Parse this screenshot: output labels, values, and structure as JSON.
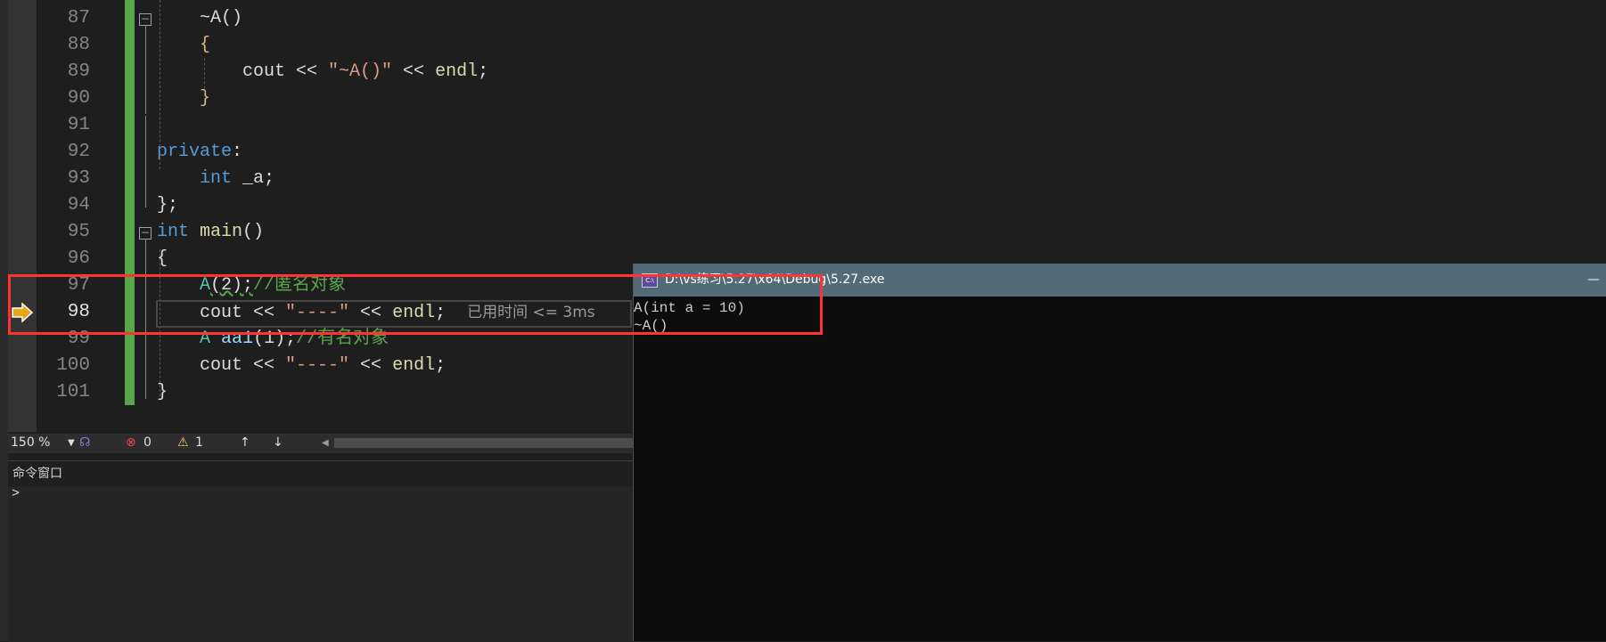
{
  "editor": {
    "current_line": 98,
    "lines": [
      {
        "n": "87",
        "tokens": [
          {
            "t": "    ~A()",
            "c": "#dcdcdc"
          }
        ]
      },
      {
        "n": "88",
        "tokens": [
          {
            "t": "    {",
            "c": "#d7ba7d"
          }
        ]
      },
      {
        "n": "89",
        "tokens": [
          {
            "t": "        cout << ",
            "c": "#dcdcdc"
          },
          {
            "t": "\"~A()\"",
            "c": "#d69d85"
          },
          {
            "t": " << ",
            "c": "#dcdcdc"
          },
          {
            "t": "endl",
            "c": "#dcdcaa"
          },
          {
            "t": ";",
            "c": "#dcdcdc"
          }
        ]
      },
      {
        "n": "90",
        "tokens": [
          {
            "t": "    }",
            "c": "#d7ba7d"
          }
        ]
      },
      {
        "n": "91",
        "tokens": []
      },
      {
        "n": "92",
        "tokens": [
          {
            "t": "private",
            "c": "#569cd6"
          },
          {
            "t": ":",
            "c": "#dcdcdc"
          }
        ]
      },
      {
        "n": "93",
        "tokens": [
          {
            "t": "    ",
            "c": "#dcdcdc"
          },
          {
            "t": "int",
            "c": "#569cd6"
          },
          {
            "t": " _a;",
            "c": "#dcdcdc"
          }
        ]
      },
      {
        "n": "94",
        "tokens": [
          {
            "t": "};",
            "c": "#dcdcdc"
          }
        ]
      },
      {
        "n": "95",
        "tokens": [
          {
            "t": "int",
            "c": "#569cd6"
          },
          {
            "t": " ",
            "c": "#dcdcdc"
          },
          {
            "t": "main",
            "c": "#dcdcaa"
          },
          {
            "t": "()",
            "c": "#dcdcdc"
          }
        ]
      },
      {
        "n": "96",
        "tokens": [
          {
            "t": "{",
            "c": "#dcdcdc"
          }
        ]
      },
      {
        "n": "97",
        "tokens": [
          {
            "t": "    ",
            "c": "#dcdcdc"
          },
          {
            "t": "A",
            "c": "#4ec9b0"
          },
          {
            "t": "(2);",
            "c": "#dcdcdc"
          },
          {
            "t": "//匿名对象",
            "c": "#57a64a"
          }
        ]
      },
      {
        "n": "98",
        "tokens": [
          {
            "t": "    cout << ",
            "c": "#dcdcdc"
          },
          {
            "t": "\"----\"",
            "c": "#d69d85"
          },
          {
            "t": " << ",
            "c": "#dcdcdc"
          },
          {
            "t": "endl",
            "c": "#dcdcaa"
          },
          {
            "t": ";  ",
            "c": "#dcdcdc"
          }
        ]
      },
      {
        "n": "99",
        "tokens": [
          {
            "t": "    ",
            "c": "#dcdcdc"
          },
          {
            "t": "A",
            "c": "#4ec9b0"
          },
          {
            "t": " ",
            "c": "#dcdcdc"
          },
          {
            "t": "aa1",
            "c": "#9cdcfe"
          },
          {
            "t": "(1);",
            "c": "#dcdcdc"
          },
          {
            "t": "//有名对象",
            "c": "#57a64a"
          }
        ]
      },
      {
        "n": "100",
        "tokens": [
          {
            "t": "    cout << ",
            "c": "#dcdcdc"
          },
          {
            "t": "\"----\"",
            "c": "#d69d85"
          },
          {
            "t": " << ",
            "c": "#dcdcdc"
          },
          {
            "t": "endl",
            "c": "#dcdcaa"
          },
          {
            "t": ";",
            "c": "#dcdcdc"
          }
        ]
      },
      {
        "n": "101",
        "tokens": [
          {
            "t": "}",
            "c": "#dcdcdc"
          }
        ]
      }
    ],
    "elapsed_hint": "已用时间 <= 3ms"
  },
  "status_bar": {
    "zoom": "150 %",
    "errors": "0",
    "warnings": "1"
  },
  "command_window": {
    "title": "命令窗口",
    "prompt": ">"
  },
  "console": {
    "title": "D:\\vs练习\\5.27\\x64\\Debug\\5.27.exe",
    "icon_label": "C:\\",
    "minimize": "—",
    "output": [
      "A(int a = 10)",
      "~A()"
    ]
  },
  "colors": {
    "accent_green": "#57a64a",
    "highlight_red": "#ff3333",
    "console_title": "#536b78"
  }
}
